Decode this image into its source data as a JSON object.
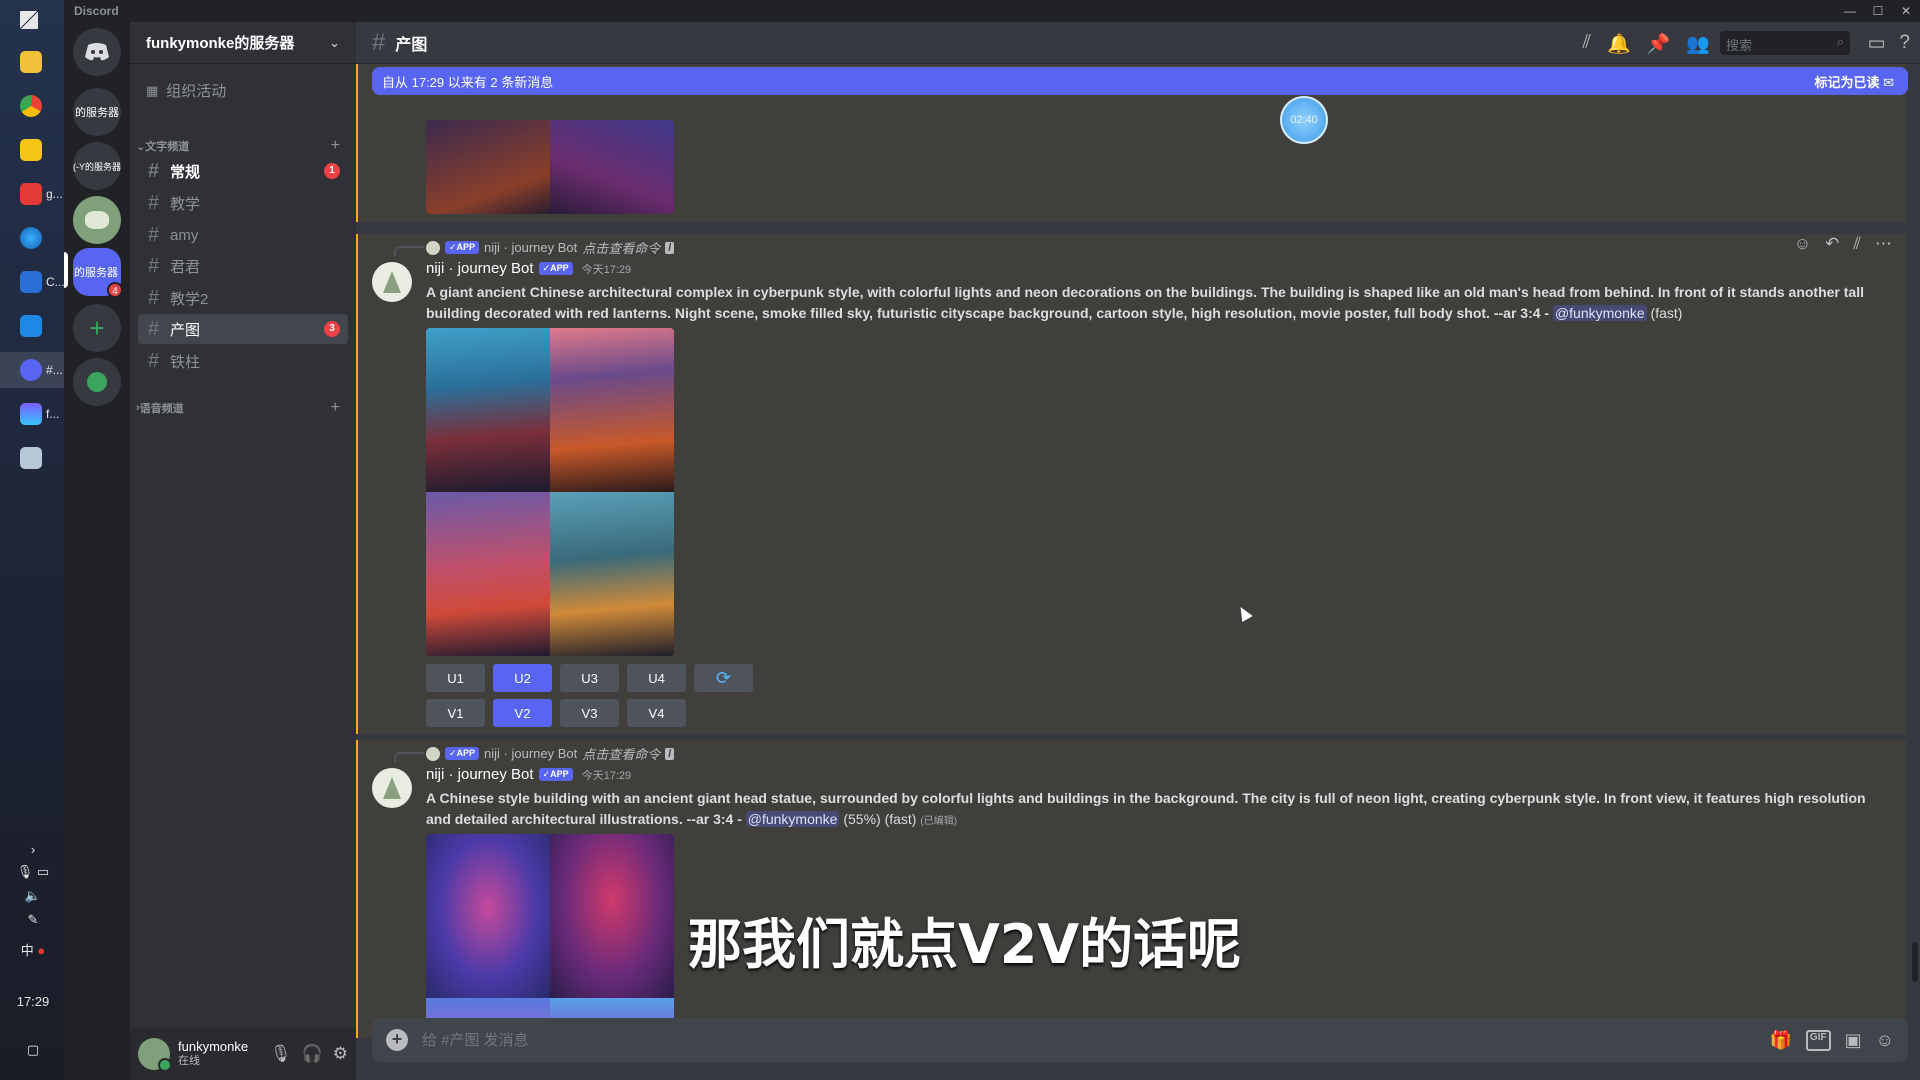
{
  "window": {
    "app_name": "Discord",
    "controls": [
      "—",
      "☐",
      "✕"
    ]
  },
  "taskbar": {
    "items": [
      {
        "icon": "windows-start-icon",
        "label": ""
      },
      {
        "icon": "folder-icon",
        "label": ""
      },
      {
        "icon": "chrome-icon",
        "label": ""
      },
      {
        "icon": "chat-app-icon",
        "label": ""
      },
      {
        "icon": "wps-icon",
        "label": "g..."
      },
      {
        "icon": "browser-icon",
        "label": ""
      },
      {
        "icon": "discord-task-icon",
        "label": "C..."
      },
      {
        "icon": "store-icon",
        "label": ""
      },
      {
        "icon": "discord-active-icon",
        "label": "#..."
      },
      {
        "icon": "image-app-icon",
        "label": "f..."
      },
      {
        "icon": "notes-icon",
        "label": ""
      }
    ],
    "tray_ime": "中",
    "clock": "17:29"
  },
  "guilds": {
    "home_icon": "discord-home-icon",
    "items": [
      {
        "label": "的服务器",
        "badge": ""
      },
      {
        "label": "(-Y的服务器",
        "badge": ""
      },
      {
        "label": "",
        "badge": ""
      },
      {
        "label": "的服务器",
        "badge": "4"
      }
    ],
    "add_label": "+",
    "explore_icon": "compass-icon"
  },
  "server": {
    "name": "funkymonke的服务器",
    "events_label": "组织活动",
    "text_category": "文字频道",
    "voice_category": "语音频道",
    "channels": [
      {
        "name": "常规",
        "badge": "1",
        "state": "unread"
      },
      {
        "name": "教学",
        "badge": "",
        "state": ""
      },
      {
        "name": "amy",
        "badge": "",
        "state": ""
      },
      {
        "name": "君君",
        "badge": "",
        "state": ""
      },
      {
        "name": "教学2",
        "badge": "",
        "state": ""
      },
      {
        "name": "产图",
        "badge": "3",
        "state": "selected"
      },
      {
        "name": "铁柱",
        "badge": "",
        "state": ""
      }
    ]
  },
  "user": {
    "name": "funkymonke",
    "status": "在线"
  },
  "chat": {
    "channel": "产图",
    "search_placeholder": "搜索",
    "new_messages": "自从 17:29 以来有 2 条新消息",
    "mark_read": "标记为已读",
    "timer": "02:40",
    "messages": [
      {
        "reply_app_tag": "✓APP",
        "reply_user": "niji · journey Bot",
        "reply_cmd": "点击查看命令",
        "author": "niji · journey Bot",
        "app_tag": "✓APP",
        "time": "今天17:29",
        "prompt": "A giant ancient Chinese architectural complex in cyberpunk style, with colorful lights and neon decorations on the buildings. The building is shaped like an old man's head from behind. In front of it stands another tall building decorated with red lanterns. Night scene, smoke filled sky, futuristic cityscape background, cartoon style, high resolution, movie poster, full body shot. --ar 3:4 -",
        "mention": "@funkymonke",
        "suffix": "(fast)",
        "upscale": [
          "U1",
          "U2",
          "U3",
          "U4"
        ],
        "variation": [
          "V1",
          "V2",
          "V3",
          "V4"
        ],
        "reroll_icon": "reroll-icon"
      },
      {
        "reply_app_tag": "✓APP",
        "reply_user": "niji · journey Bot",
        "reply_cmd": "点击查看命令",
        "author": "niji · journey Bot",
        "app_tag": "✓APP",
        "time": "今天17:29",
        "prompt": "A Chinese style building with an ancient giant head statue, surrounded by colorful lights and buildings in the background. The city is full of neon light, creating cyberpunk style. In front view, it features high resolution and detailed architectural illustrations. --ar 3:4 -",
        "mention": "@funkymonke",
        "suffix": "(55%) (fast)",
        "edited": "(已编辑)"
      }
    ],
    "subtitle": "那我们就点V2V的话呢",
    "composer_placeholder": "给 #产图 发消息"
  },
  "colors": {
    "accent": "#5865f2",
    "danger": "#ed4245",
    "online": "#3ba55d"
  }
}
